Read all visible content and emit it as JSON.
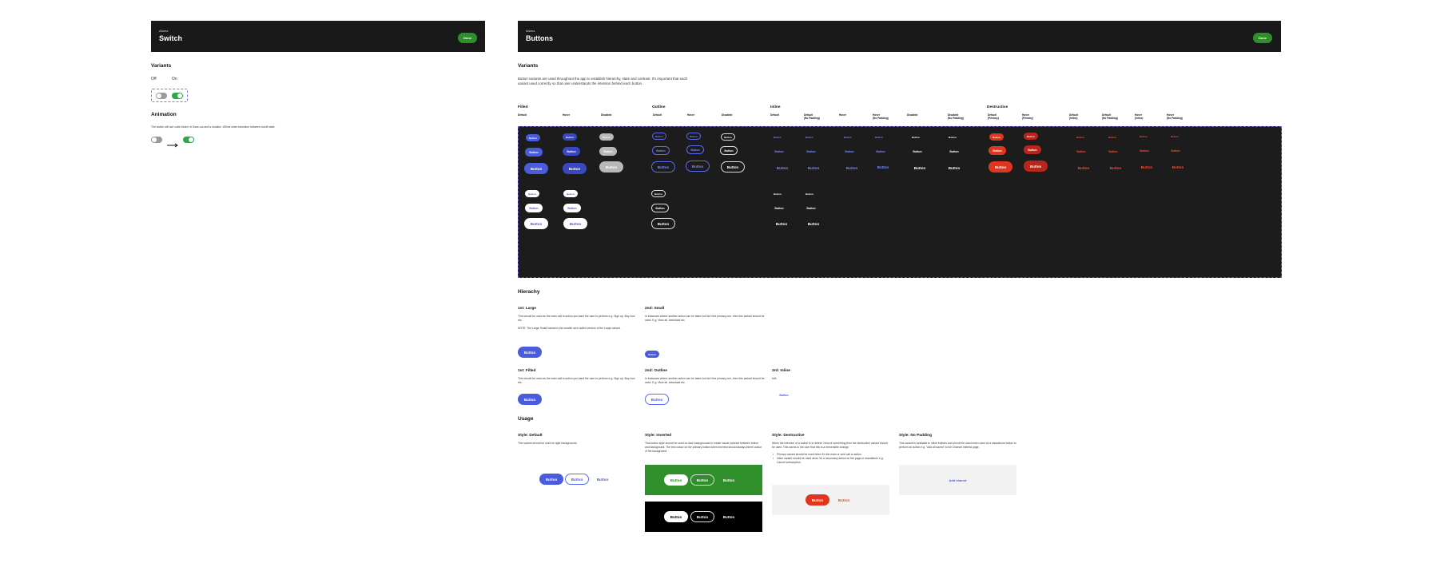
{
  "switch_panel": {
    "eyebrow": "Atoms",
    "title": "Switch",
    "done": "Done",
    "variants_heading": "Variants",
    "off_label": "Off",
    "on_label": "On",
    "animation_heading": "Animation",
    "animation_text": "The switch will use cubic bezier of Ease-out and a duration 150ms when transition between on/off state."
  },
  "buttons_panel": {
    "eyebrow": "Atoms",
    "title": "Buttons",
    "done": "Done",
    "variants_heading": "Variants",
    "variants_text": "Button variants are used throughout the app to establish hierarchy, state and contrast. It's important that each variant used correctly so that user understands the intention behind each button.",
    "groups": {
      "filled": "Filled",
      "outline": "Outline",
      "inline": "Inline",
      "destructive": "Destructive"
    },
    "columns": {
      "f_default": "Default",
      "f_hover": "Hover",
      "f_disabled": "Disabled",
      "o_default": "Default",
      "o_hover": "Hover",
      "o_disabled": "Disabled",
      "i_default": "Default",
      "i_default_np": "Default\n(No Padding)",
      "i_hover": "Hover",
      "i_hover_np": "Hover\n(No Padding)",
      "i_disabled": "Disabled",
      "i_disabled_np": "Disabled\n(No Padding)",
      "d_default_primary": "Default\n(Primary)",
      "d_hover_primary": "Hover\n(Primary)",
      "d_default_inline": "Default\n(Inline)",
      "d_default_np": "Default\n(No Padding)",
      "d_hover_inline": "Hover\n(Inline)",
      "d_hover_np": "Hover\n(No Padding)"
    },
    "button_label": "Button"
  },
  "hierarchy": {
    "heading": "Hierachy",
    "large_title": "1st: Large",
    "large_text": "This should be used as the main call to action you want the user to perform e.g. Sign up, Buy now etc.",
    "large_note": "NOTE: The Large Small Variant is the smaller and scaled version of the Large variant.",
    "small_title": "2nd: Small",
    "small_text": "In instances where another action can be taken but isn't the primary one, then this variant should be used. E.g. View all, download etc.",
    "filled_title": "1st: Filled",
    "filled_text": "This should be used as the main call to action you want the user to perform e.g. Sign up, Buy now etc.",
    "outline_title": "2nd: Outline",
    "outline_text": "In instances where another action can be taken but isn't the primary one, then this variant should be used. E.g. View all, download etc.",
    "inline_title": "3rd: Inline",
    "inline_text": "N/A"
  },
  "usage": {
    "heading": "Usage",
    "default_title": "Style: Default",
    "default_text": "This variant should be used on light backgrounds.",
    "inverted_title": "Style: Inverted",
    "inverted_text": "This button style should be used on dark backgrounds to create visual contrast between button and background. The text colour on the primary button when inverted should always inherit colour of the background.",
    "destructive_title": "Style: Destructive",
    "destructive_text": "When the intention of a button is to delete, remove something then the destructive variant should be used. This warns to the user that this is a irreversible change.",
    "destructive_bullet1": "Primary variant should be used when it's the main or sole call to action",
    "destructive_bullet2": "Inline variant should be used when it's a secondary action on the page or standalone e.g. Cancel subscription.",
    "nopad_title": "Style: No Padding",
    "nopad_text": "This variant is available to inline buttons and should be used when used as a standalone button to perform an action e.g. \"Add all saved\" to the Charset Interest page.",
    "add_saved": "Add shared"
  },
  "colors": {
    "primary": "#4a5bdc",
    "success": "#2f8f2b",
    "destructive": "#e0351e",
    "dark": "#1c1c1c"
  }
}
